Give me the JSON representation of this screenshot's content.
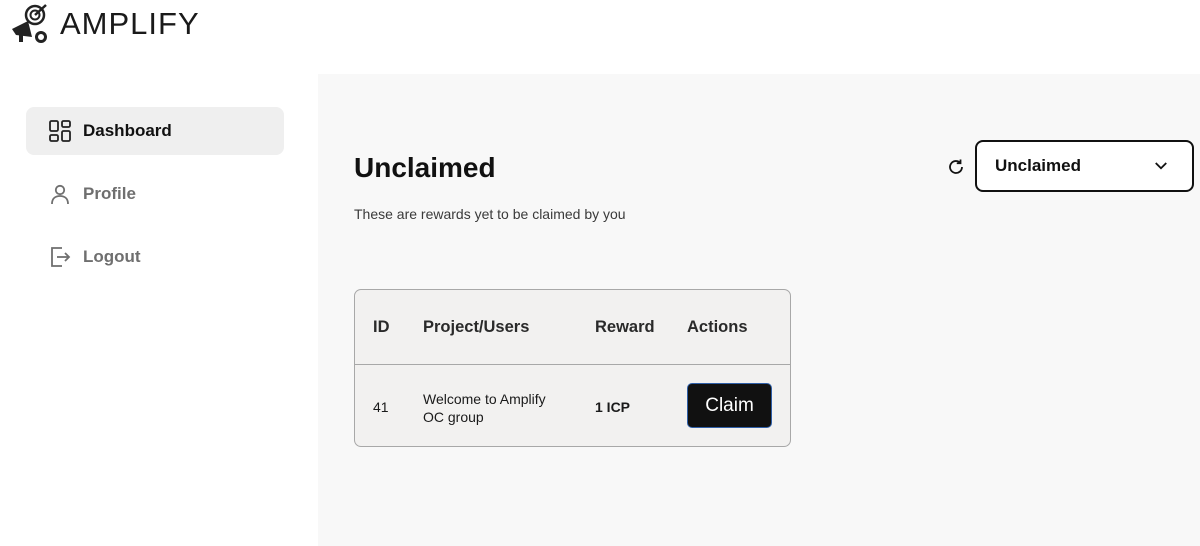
{
  "app": {
    "name": "AMPLIFY",
    "logo_icon": "megaphone-target-icon"
  },
  "sidebar": {
    "items": [
      {
        "label": "Dashboard",
        "icon": "grid-icon",
        "active": true
      },
      {
        "label": "Profile",
        "icon": "user-icon",
        "active": false
      },
      {
        "label": "Logout",
        "icon": "logout-icon",
        "active": false
      }
    ]
  },
  "main": {
    "title": "Unclaimed",
    "subtitle": "These are rewards yet to be claimed by you",
    "refresh_icon": "refresh-icon",
    "filter": {
      "selected": "Unclaimed",
      "icon": "chevron-down-icon"
    },
    "table": {
      "columns": [
        "ID",
        "Project/Users",
        "Reward",
        "Actions"
      ],
      "rows": [
        {
          "id": "41",
          "project_line1": "Welcome to Amplify",
          "project_line2": "OC group",
          "reward": "1 ICP",
          "action_label": "Claim"
        }
      ]
    }
  },
  "colors": {
    "main_bg": "#f8f8f8",
    "active_nav_bg": "#efefef",
    "button_bg": "#111111",
    "button_border": "#2f5fa8"
  }
}
